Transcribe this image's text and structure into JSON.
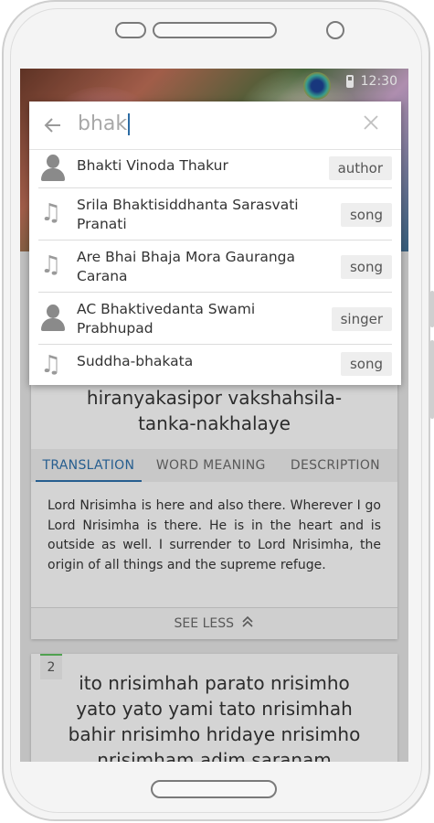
{
  "status": {
    "time": "12:30"
  },
  "search": {
    "query": "bhak",
    "back_icon": "arrow-left-icon",
    "clear_icon": "close-icon"
  },
  "results": [
    {
      "icon": "person-icon",
      "title": "Bhakti Vinoda Thakur",
      "tag": "author"
    },
    {
      "icon": "music-note-icon",
      "title": "Srila Bhaktisiddhanta Sarasvati Pranati",
      "tag": "song"
    },
    {
      "icon": "music-note-icon",
      "title": "Are Bhai Bhaja Mora Gauranga Carana",
      "tag": "song"
    },
    {
      "icon": "person-icon",
      "title": "AC Bhaktivedanta Swami Prabhupad",
      "tag": "singer"
    },
    {
      "icon": "music-note-icon",
      "title": "Suddha-bhakata",
      "tag": "song"
    }
  ],
  "verse1": {
    "lines": [
      "hiranyakasipor vakshahsila-",
      "tanka-nakhalaye"
    ],
    "tabs": [
      "TRANSLATION",
      "WORD MEANING",
      "DESCRIPTION"
    ],
    "translation": "Lord Nrisimha is here and also there. Wherever I go Lord Nrisimha is there. He is in the heart and is outside as well. I surrender to Lord Nrisimha, the origin of all things and the supreme refuge.",
    "see_less": "SEE LESS"
  },
  "verse2": {
    "number": "2",
    "lines": [
      "ito nrisimhah parato nrisimho",
      "yato yato yami tato nrisimhah",
      "bahir nrisimho hridaye nrisimho",
      "nrisimham adim saranam"
    ]
  }
}
